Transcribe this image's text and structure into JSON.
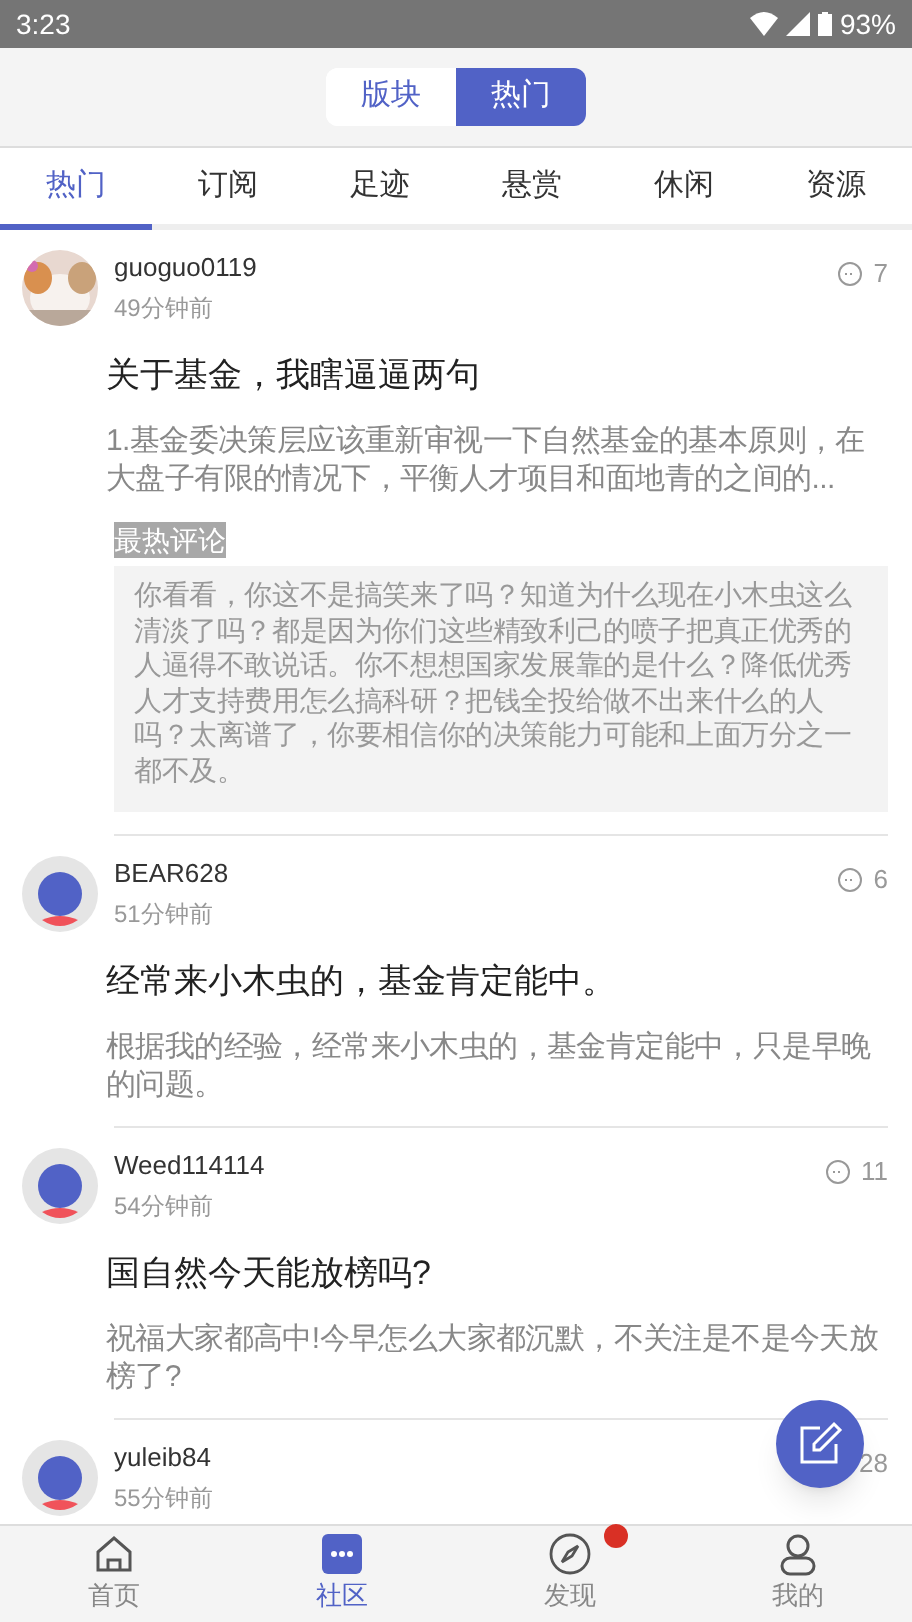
{
  "status_bar": {
    "time": "3:23",
    "battery": "93%"
  },
  "segmented": [
    {
      "label": "版块",
      "selected": false
    },
    {
      "label": "热门",
      "selected": true
    }
  ],
  "tabs": [
    {
      "label": "热门",
      "selected": true
    },
    {
      "label": "订阅",
      "selected": false
    },
    {
      "label": "足迹",
      "selected": false
    },
    {
      "label": "悬赏",
      "selected": false
    },
    {
      "label": "休闲",
      "selected": false
    },
    {
      "label": "资源",
      "selected": false
    }
  ],
  "posts": [
    {
      "user": "guoguo0119",
      "time": "49分钟前",
      "comments": "7",
      "title": "关于基金，我瞎逼逼两句",
      "body": "1.基金委决策层应该重新审视一下自然基金的基本原则，在大盘子有限的情况下，平衡人才项目和面地青的之间的...",
      "hot_comment": {
        "label": "最热评论",
        "text": "你看看，你这不是搞笑来了吗？知道为什么现在小木虫这么清淡了吗？都是因为你们这些精致利己的喷子把真正优秀的人逼得不敢说话。你不想想国家发展靠的是什么？降低优秀人才支持费用怎么搞科研？把钱全投给做不出来什么的人吗？太离谱了，你要相信你的决策能力可能和上面万分之一都不及。"
      }
    },
    {
      "kind": "default",
      "user": "BEAR628",
      "time": "51分钟前",
      "comments": "6",
      "title": "经常来小木虫的，基金肯定能中。",
      "body": "根据我的经验，经常来小木虫的，基金肯定能中，只是早晚的问题。"
    },
    {
      "kind": "default",
      "user": "Weed114114",
      "time": "54分钟前",
      "comments": "11",
      "title": "国自然今天能放榜吗?",
      "body": "祝福大家都高中!今早怎么大家都沉默，不关注是不是今天放榜了?"
    },
    {
      "kind": "default",
      "user": "yuleib84",
      "time": "55分钟前",
      "comments": "28"
    }
  ],
  "nav": [
    {
      "kind": "home",
      "label": "首页",
      "selected": false,
      "badge": false
    },
    {
      "kind": "community",
      "label": "社区",
      "selected": true,
      "badge": false
    },
    {
      "kind": "compass",
      "label": "发现",
      "selected": false,
      "badge": true
    },
    {
      "kind": "user",
      "label": "我的",
      "selected": false,
      "badge": false
    }
  ]
}
